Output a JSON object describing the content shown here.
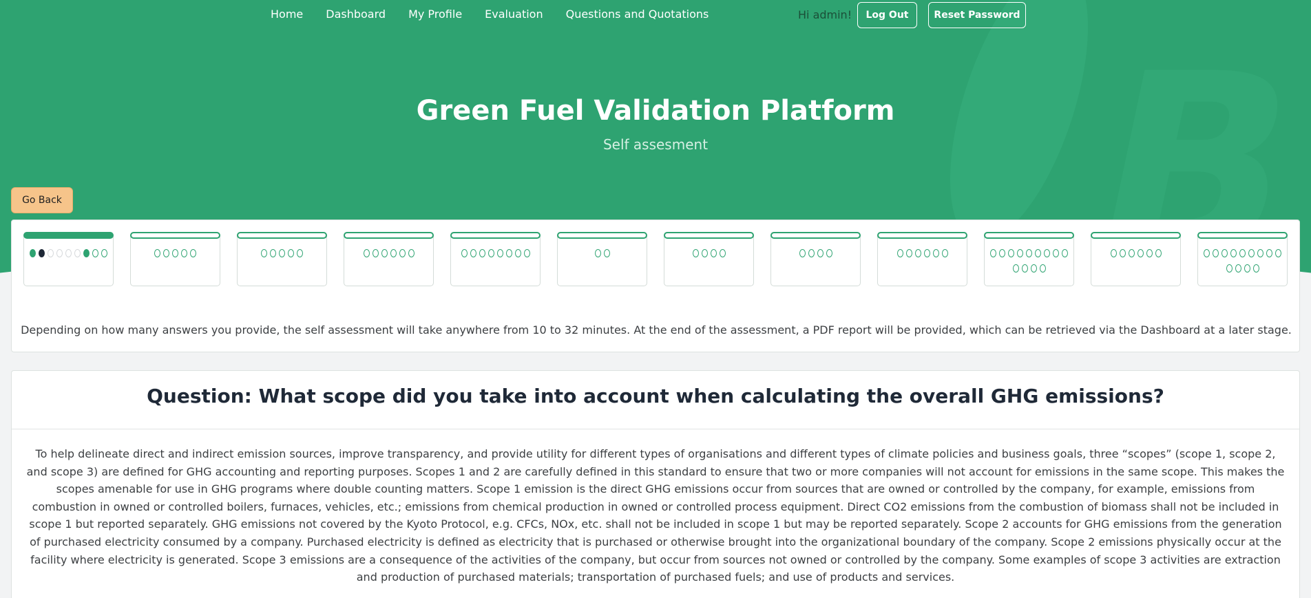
{
  "nav": {
    "links": [
      "Home",
      "Dashboard",
      "My Profile",
      "Evaluation",
      "Questions and Quotations"
    ],
    "greeting": "Hi admin!",
    "logout_label": "Log Out",
    "reset_password_label": "Reset Password"
  },
  "header": {
    "title": "Green Fuel Validation Platform",
    "subtitle": "Self assesment"
  },
  "go_back_label": "Go Back",
  "colors": {
    "brand_green": "#2ea371",
    "go_back": "#f6c48a",
    "current_dot": "#1f2937"
  },
  "progress": {
    "active_section": 1,
    "sections": [
      {
        "dots": [
          "filled",
          "current",
          "pending",
          "pending",
          "pending",
          "pending",
          "filled",
          "open",
          "open"
        ]
      },
      {
        "dots": [
          "open",
          "open",
          "open",
          "open",
          "open"
        ]
      },
      {
        "dots": [
          "open",
          "open",
          "open",
          "open",
          "open"
        ]
      },
      {
        "dots": [
          "open",
          "open",
          "open",
          "open",
          "open",
          "open"
        ]
      },
      {
        "dots": [
          "open",
          "open",
          "open",
          "open",
          "open",
          "open",
          "open",
          "open"
        ]
      },
      {
        "dots": [
          "open",
          "open"
        ]
      },
      {
        "dots": [
          "open",
          "open",
          "open",
          "open"
        ]
      },
      {
        "dots": [
          "open",
          "open",
          "open",
          "open"
        ]
      },
      {
        "dots": [
          "open",
          "open",
          "open",
          "open",
          "open",
          "open"
        ]
      },
      {
        "dots": [
          "open",
          "open",
          "open",
          "open",
          "open",
          "open",
          "open",
          "open",
          "open",
          "open",
          "open",
          "open",
          "open"
        ]
      },
      {
        "dots": [
          "open",
          "open",
          "open",
          "open",
          "open",
          "open"
        ]
      },
      {
        "dots": [
          "open",
          "open",
          "open",
          "open",
          "open",
          "open",
          "open",
          "open",
          "open",
          "open",
          "open",
          "open",
          "open"
        ]
      }
    ],
    "intro_text": "Depending on how many answers you provide, the self assessment will take anywhere from 10 to 32 minutes. At the end of the assessment, a PDF report will be provided, which can be retrieved via the Dashboard at a later stage."
  },
  "question": {
    "title": "Question: What scope did you take into account when calculating the overall GHG emissions?",
    "description": "To help delineate direct and indirect emission sources, improve transparency, and provide utility for different types of organisations and different types of climate policies and business goals, three “scopes” (scope 1, scope 2, and scope 3) are defined for GHG accounting and reporting purposes. Scopes 1 and 2 are carefully defined in this standard to ensure that two or more companies will not account for emissions in the same scope. This makes the scopes amenable for use in GHG programs where double counting matters. Scope 1 emission is the direct GHG emissions occur from sources that are owned or controlled by the company, for example, emissions from combustion in owned or controlled boilers, furnaces, vehicles, etc.; emissions from chemical production in owned or controlled process equipment. Direct CO2 emissions from the combustion of biomass shall not be included in scope 1 but reported separately. GHG emissions not covered by the Kyoto Protocol, e.g. CFCs, NOx, etc. shall not be included in scope 1 but may be reported separately. Scope 2 accounts for GHG emissions from the generation of purchased electricity consumed by a company. Purchased electricity is defined as electricity that is purchased or otherwise brought into the organizational boundary of the company. Scope 2 emissions physically occur at the facility where electricity is generated. Scope 3 emissions are a consequence of the activities of the company, but occur from sources not owned or controlled by the company. Some examples of scope 3 activities are extraction and production of purchased materials; transportation of purchased fuels; and use of products and services."
  }
}
